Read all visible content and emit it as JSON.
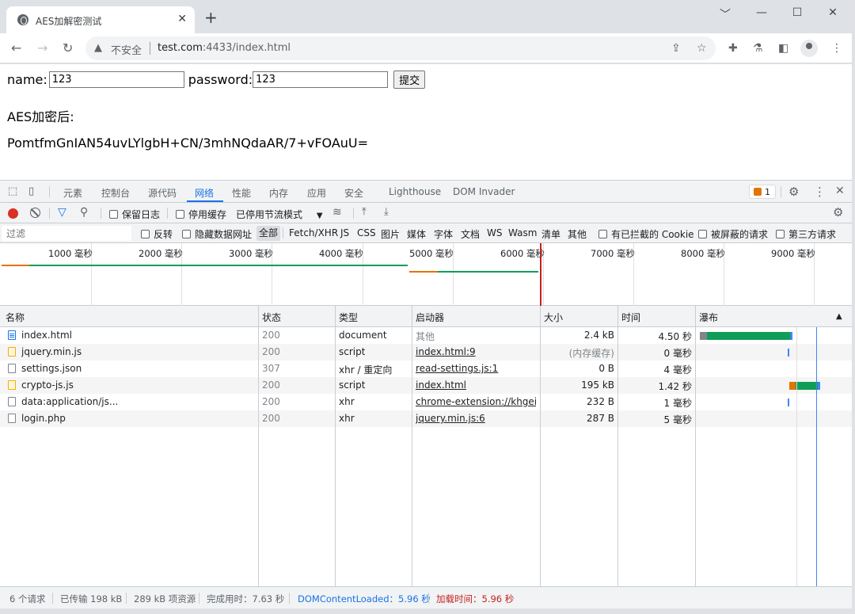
{
  "browser": {
    "tab_title": "AES加解密测试",
    "tab_close": "✕",
    "new_tab": "+",
    "window": {
      "minimize": "﹀",
      "restore": "—",
      "maximize": "☐",
      "close": "✕"
    },
    "nav": {
      "back": "←",
      "forward": "→",
      "reload": "↻"
    },
    "address": {
      "security_label": "不安全",
      "host": "test.com",
      "rest": ":4433/index.html"
    },
    "icons": [
      "share-icon",
      "star-icon",
      "extensions-icon",
      "lab-icon",
      "sidepanel-icon",
      "profile-icon",
      "menu-icon"
    ]
  },
  "page": {
    "name_label": "name:",
    "name_value": "123",
    "password_label": "password:",
    "password_value": "123",
    "submit_label": "提交",
    "aes_label": "AES加密后:",
    "aes_value": "PomtfmGnIAN54uvLYlgbH+CN/3mhNQdaAR/7+vFOAuU="
  },
  "devtools": {
    "tabs": [
      "元素",
      "控制台",
      "源代码",
      "网络",
      "性能",
      "内存",
      "应用",
      "安全",
      "Lighthouse",
      "DOM Invader"
    ],
    "active_tab": "网络",
    "issues_count": "1",
    "toolbar": {
      "preserve_log": "保留日志",
      "disable_cache": "停用缓存",
      "throttling": "已停用节流模式",
      "throttle_arrow": "▼"
    },
    "filter": {
      "placeholder": "过滤",
      "invert": "反转",
      "hide_data_urls": "隐藏数据网址",
      "types": [
        "全部",
        "Fetch/XHR",
        "JS",
        "CSS",
        "图片",
        "媒体",
        "字体",
        "文档",
        "WS",
        "Wasm",
        "清单",
        "其他"
      ],
      "blocked_cookies": "有已拦截的 Cookie",
      "blocked_requests": "被屏蔽的请求",
      "third_party": "第三方请求"
    },
    "overview_ticks": [
      "1000 毫秒",
      "2000 毫秒",
      "3000 毫秒",
      "4000 毫秒",
      "5000 毫秒",
      "6000 毫秒",
      "7000 毫秒",
      "8000 毫秒",
      "9000 毫秒"
    ],
    "columns": [
      "名称",
      "状态",
      "类型",
      "启动器",
      "大小",
      "时间",
      "瀑布"
    ],
    "sort_indicator": "▲",
    "requests": [
      {
        "name": "index.html",
        "status": "200",
        "type": "document",
        "initiator": "其他",
        "size": "2.4 kB",
        "time": "4.50 秒",
        "icon": "document-icon"
      },
      {
        "name": "jquery.min.js",
        "status": "200",
        "type": "script",
        "initiator": "index.html:9",
        "size": "(内存缓存)",
        "time": "0 毫秒",
        "icon": "script-icon"
      },
      {
        "name": "settings.json",
        "status": "307",
        "type": "xhr / 重定向",
        "initiator": "read-settings.js:1",
        "size": "0 B",
        "time": "4 毫秒",
        "icon": "file-icon"
      },
      {
        "name": "crypto-js.js",
        "status": "200",
        "type": "script",
        "initiator": "index.html",
        "size": "195 kB",
        "time": "1.42 秒",
        "icon": "script-icon"
      },
      {
        "name": "data:application/js...",
        "status": "200",
        "type": "xhr",
        "initiator": "chrome-extension://khgeik...",
        "size": "232 B",
        "time": "1 毫秒",
        "icon": "file-icon"
      },
      {
        "name": "login.php",
        "status": "200",
        "type": "xhr",
        "initiator": "jquery.min.js:6",
        "size": "287 B",
        "time": "5 毫秒",
        "icon": "file-icon"
      }
    ],
    "status_bar": {
      "requests": "6 个请求",
      "transferred": "已传输 198 kB",
      "resources": "289 kB 项资源",
      "finish": "完成用时：7.63 秒",
      "dcl": "DOMContentLoaded：5.96 秒",
      "load": "加载时间：5.96 秒"
    }
  },
  "colors": {
    "accent": "#1a73e8",
    "record": "#d93025",
    "waterfall_receive": "#0f9d58",
    "waterfall_wait": "#80868b",
    "waterfall_script": "#e37400",
    "load_line": "#c5221f"
  }
}
